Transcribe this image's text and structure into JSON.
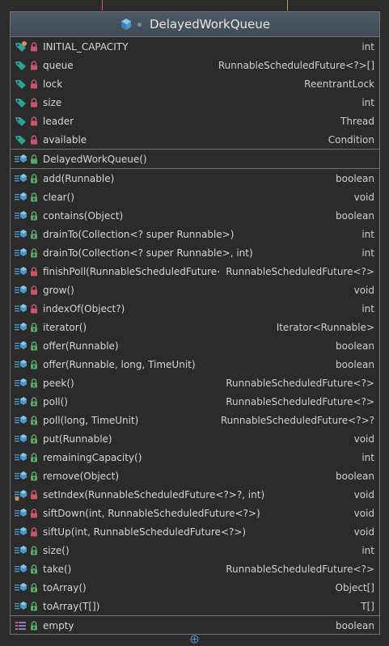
{
  "class": {
    "name": "DelayedWorkQueue",
    "icon": "class-icon"
  },
  "colors": {
    "header_bg": "#3f4c57",
    "border": "#6d7479",
    "background": "#2b2b2b",
    "field_icon": "#2aa394",
    "method_icon": "#4a98c9",
    "private_lock": "#c8566a",
    "package_lock": "#59a869"
  },
  "fields": [
    {
      "name": "INITIAL_CAPACITY",
      "type": "int",
      "icon": "static-field-icon",
      "lock": "private"
    },
    {
      "name": "queue",
      "type": "RunnableScheduledFuture<?>[]",
      "icon": "field-icon",
      "lock": "private"
    },
    {
      "name": "lock",
      "type": "ReentrantLock",
      "icon": "field-icon",
      "lock": "private"
    },
    {
      "name": "size",
      "type": "int",
      "icon": "field-icon",
      "lock": "private"
    },
    {
      "name": "leader",
      "type": "Thread",
      "icon": "field-icon",
      "lock": "private"
    },
    {
      "name": "available",
      "type": "Condition",
      "icon": "field-icon",
      "lock": "private"
    }
  ],
  "constructors": [
    {
      "name": "DelayedWorkQueue()",
      "type": "",
      "icon": "constructor-icon",
      "lock": "package"
    }
  ],
  "methods": [
    {
      "name": "add(Runnable)",
      "type": "boolean",
      "icon": "method-icon",
      "lock": "public"
    },
    {
      "name": "clear()",
      "type": "void",
      "icon": "method-icon",
      "lock": "public"
    },
    {
      "name": "contains(Object)",
      "type": "boolean",
      "icon": "method-icon",
      "lock": "public"
    },
    {
      "name": "drainTo(Collection<? super Runnable>)",
      "type": "int",
      "icon": "method-icon",
      "lock": "public"
    },
    {
      "name": "drainTo(Collection<? super Runnable>, int)",
      "type": "int",
      "icon": "method-icon",
      "lock": "public"
    },
    {
      "name": "finishPoll(RunnableScheduledFuture<?>)",
      "type": "RunnableScheduledFuture<?>",
      "icon": "method-icon",
      "lock": "private"
    },
    {
      "name": "grow()",
      "type": "void",
      "icon": "method-icon",
      "lock": "private"
    },
    {
      "name": "indexOf(Object?)",
      "type": "int",
      "icon": "method-icon",
      "lock": "private"
    },
    {
      "name": "iterator()",
      "type": "Iterator<Runnable>",
      "icon": "method-icon",
      "lock": "public"
    },
    {
      "name": "offer(Runnable)",
      "type": "boolean",
      "icon": "method-icon",
      "lock": "public"
    },
    {
      "name": "offer(Runnable, long, TimeUnit)",
      "type": "boolean",
      "icon": "method-icon",
      "lock": "public"
    },
    {
      "name": "peek()",
      "type": "RunnableScheduledFuture<?>",
      "icon": "method-icon",
      "lock": "public"
    },
    {
      "name": "poll()",
      "type": "RunnableScheduledFuture<?>",
      "icon": "method-icon",
      "lock": "public"
    },
    {
      "name": "poll(long, TimeUnit)",
      "type": "RunnableScheduledFuture<?>?",
      "icon": "method-icon",
      "lock": "public"
    },
    {
      "name": "put(Runnable)",
      "type": "void",
      "icon": "method-icon",
      "lock": "public"
    },
    {
      "name": "remainingCapacity()",
      "type": "int",
      "icon": "method-icon",
      "lock": "public"
    },
    {
      "name": "remove(Object)",
      "type": "boolean",
      "icon": "method-icon",
      "lock": "public"
    },
    {
      "name": "setIndex(RunnableScheduledFuture<?>?, int)",
      "type": "void",
      "icon": "static-method-icon",
      "lock": "private"
    },
    {
      "name": "siftDown(int, RunnableScheduledFuture<?>)",
      "type": "void",
      "icon": "method-icon",
      "lock": "private"
    },
    {
      "name": "siftUp(int, RunnableScheduledFuture<?>)",
      "type": "void",
      "icon": "method-icon",
      "lock": "private"
    },
    {
      "name": "size()",
      "type": "int",
      "icon": "method-icon",
      "lock": "public"
    },
    {
      "name": "take()",
      "type": "RunnableScheduledFuture<?>",
      "icon": "method-icon",
      "lock": "public"
    },
    {
      "name": "toArray()",
      "type": "Object[]",
      "icon": "method-icon",
      "lock": "public"
    },
    {
      "name": "toArray(T[])",
      "type": "T[]",
      "icon": "method-icon",
      "lock": "public"
    }
  ],
  "properties": [
    {
      "name": "empty",
      "type": "boolean",
      "icon": "property-icon",
      "lock": "public"
    }
  ]
}
